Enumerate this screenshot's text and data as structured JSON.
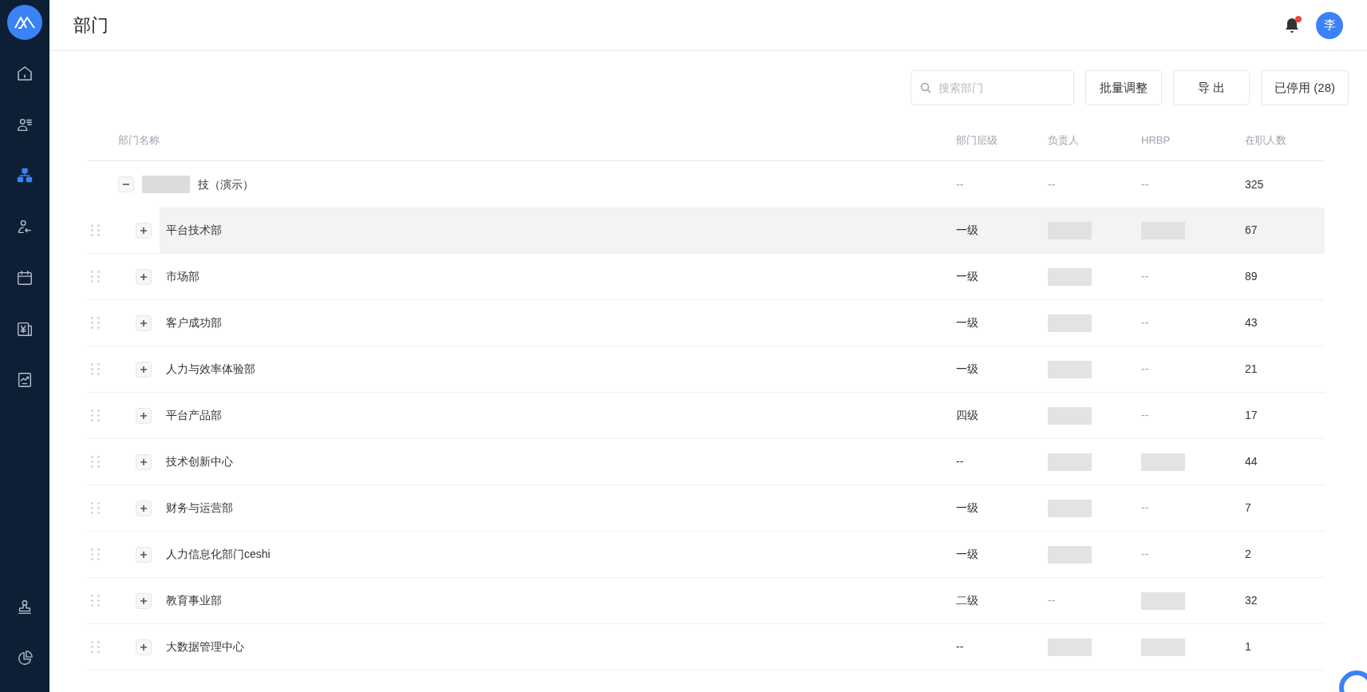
{
  "sidebar": {
    "items": [
      {
        "kind": "home",
        "selected": false
      },
      {
        "kind": "people",
        "selected": false
      },
      {
        "kind": "org",
        "selected": true
      },
      {
        "kind": "leave",
        "selected": false
      },
      {
        "kind": "calendar",
        "selected": false
      },
      {
        "kind": "payroll",
        "selected": false
      },
      {
        "kind": "report",
        "selected": false
      }
    ],
    "bottom_items": [
      {
        "kind": "stamp",
        "selected": false
      },
      {
        "kind": "pie",
        "selected": false
      }
    ]
  },
  "header": {
    "title": "部门",
    "avatar": "李",
    "has_notification": true
  },
  "toolbar": {
    "search": {
      "placeholder": "搜索部门"
    },
    "buttons": [
      "批量调整",
      "导 出",
      "已停用 (28)"
    ]
  },
  "table": {
    "columns": [
      "部门名称",
      "部门层级",
      "负责人",
      "HRBP",
      "在职人数"
    ],
    "root": {
      "name": "技（演示）",
      "name_redacted": true,
      "expanded": true,
      "level": "--",
      "owner": {
        "kind": "text",
        "text": "--"
      },
      "hrbp": {
        "kind": "text",
        "text": "--"
      },
      "count": "325"
    },
    "rows": [
      {
        "name": "平台技术部",
        "expanded": false,
        "highlighted": true,
        "level": "一级",
        "owner": {
          "kind": "redacted"
        },
        "hrbp": {
          "kind": "redacted"
        },
        "count": "67"
      },
      {
        "name": "市场部",
        "expanded": false,
        "highlighted": false,
        "level": "一级",
        "owner": {
          "kind": "redacted"
        },
        "hrbp": {
          "kind": "text",
          "text": "--"
        },
        "count": "89"
      },
      {
        "name": "客户成功部",
        "expanded": false,
        "highlighted": false,
        "level": "一级",
        "owner": {
          "kind": "redacted"
        },
        "hrbp": {
          "kind": "text",
          "text": "--"
        },
        "count": "43"
      },
      {
        "name": "人力与效率体验部",
        "expanded": false,
        "highlighted": false,
        "level": "一级",
        "owner": {
          "kind": "redacted"
        },
        "hrbp": {
          "kind": "text",
          "text": "--"
        },
        "count": "21"
      },
      {
        "name": "平台产品部",
        "expanded": false,
        "highlighted": false,
        "level": "四级",
        "owner": {
          "kind": "redacted"
        },
        "hrbp": {
          "kind": "text",
          "text": "--"
        },
        "count": "17"
      },
      {
        "name": "技术创新中心",
        "expanded": false,
        "highlighted": false,
        "level": "--",
        "owner": {
          "kind": "redacted"
        },
        "hrbp": {
          "kind": "redacted"
        },
        "count": "44"
      },
      {
        "name": "财务与运营部",
        "expanded": false,
        "highlighted": false,
        "level": "一级",
        "owner": {
          "kind": "redacted"
        },
        "hrbp": {
          "kind": "text",
          "text": "--"
        },
        "count": "7"
      },
      {
        "name": "人力信息化部门ceshi",
        "expanded": false,
        "highlighted": false,
        "level": "一级",
        "owner": {
          "kind": "redacted"
        },
        "hrbp": {
          "kind": "text",
          "text": "--"
        },
        "count": "2"
      },
      {
        "name": "教育事业部",
        "expanded": false,
        "highlighted": false,
        "level": "二级",
        "owner": {
          "kind": "text",
          "text": "--"
        },
        "hrbp": {
          "kind": "redacted"
        },
        "count": "32"
      },
      {
        "name": "大数据管理中心",
        "expanded": false,
        "highlighted": false,
        "level": "--",
        "owner": {
          "kind": "redacted"
        },
        "hrbp": {
          "kind": "redacted"
        },
        "count": "1"
      }
    ]
  }
}
